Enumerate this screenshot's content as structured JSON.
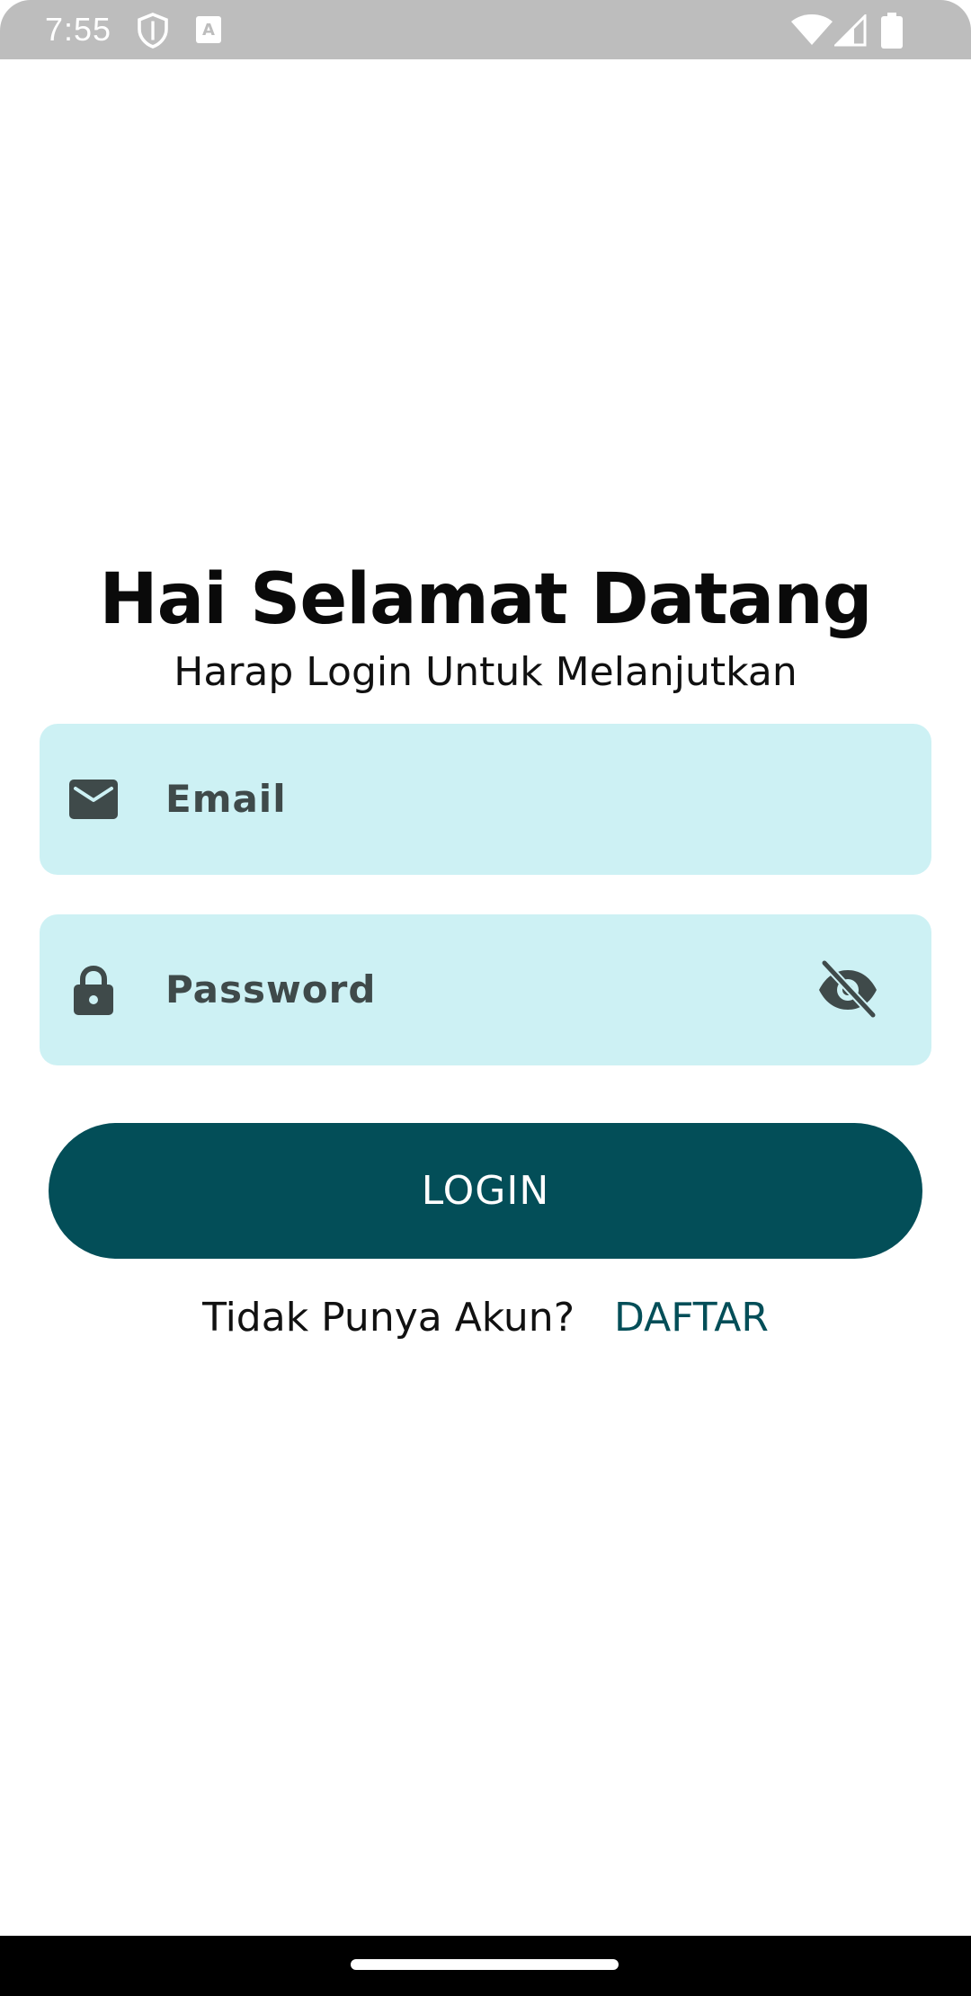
{
  "status_bar": {
    "time": "7:55",
    "icons": [
      "shield-icon",
      "keyboard-a-icon",
      "wifi-icon",
      "signal-icon",
      "battery-icon"
    ]
  },
  "header": {
    "title": "Hai Selamat Datang",
    "subtitle": "Harap Login Untuk Melanjutkan"
  },
  "form": {
    "email": {
      "placeholder": "Email",
      "value": "",
      "icon": "mail-icon"
    },
    "password": {
      "placeholder": "Password",
      "value": "",
      "icon": "lock-icon",
      "toggle_icon": "eye-off-icon"
    },
    "login_label": "LOGIN"
  },
  "register": {
    "question": "Tidak Punya Akun?",
    "link_label": "DAFTAR"
  },
  "colors": {
    "primary": "#034e58",
    "field_bg": "#cdf1f4",
    "icon": "#3f4a4a",
    "status_bar": "#bdbdbd"
  }
}
